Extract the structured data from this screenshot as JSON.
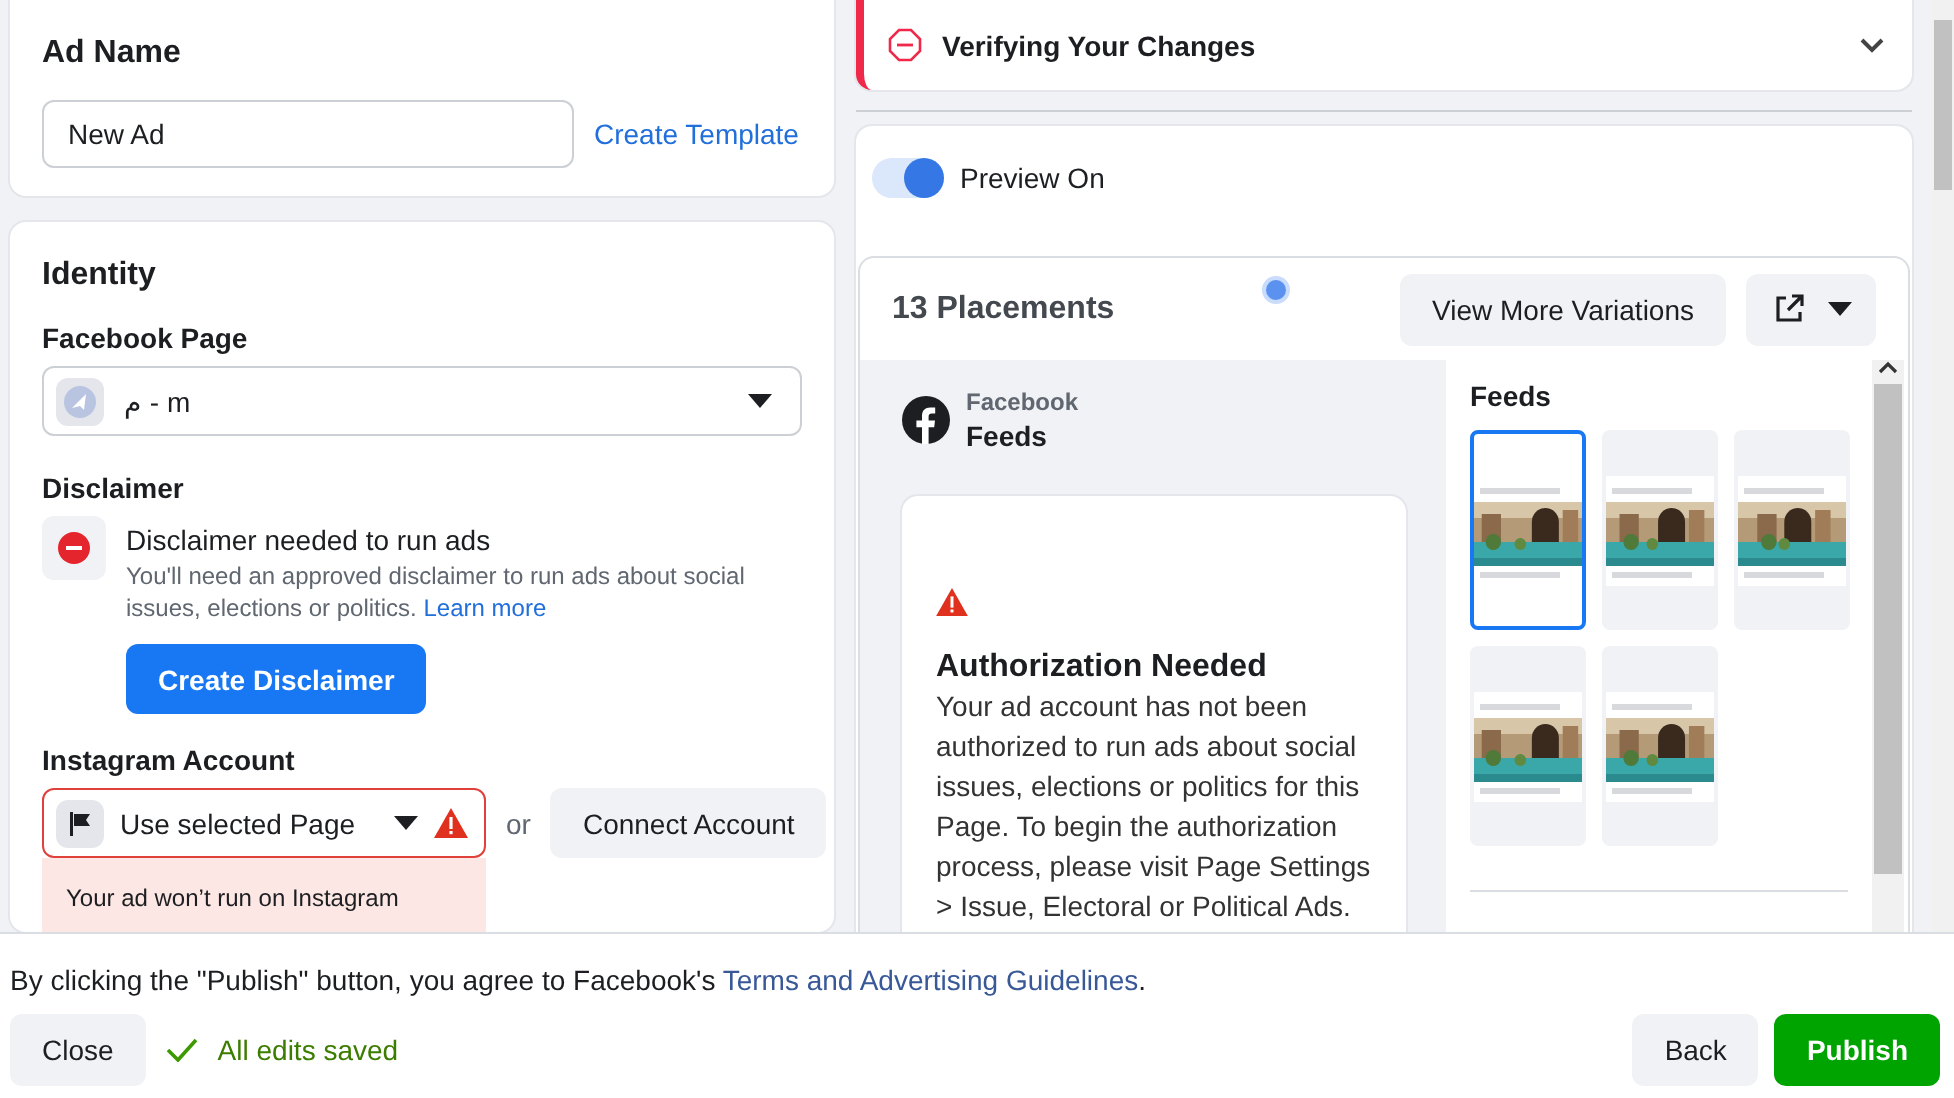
{
  "ad_name": {
    "title": "Ad Name",
    "value": "New Ad",
    "link": "Create Template"
  },
  "identity": {
    "title": "Identity",
    "facebook_page": {
      "label": "Facebook Page",
      "value": "م - m"
    },
    "disclaimer": {
      "label": "Disclaimer",
      "title": "Disclaimer needed to run ads",
      "text": "You'll need an approved disclaimer to run ads about social issues, elections or politics.",
      "link": "Learn more",
      "button": "Create Disclaimer"
    },
    "instagram": {
      "label": "Instagram Account",
      "value": "Use selected Page",
      "error": true,
      "or": "or",
      "button": "Connect Account",
      "warning": "Your ad won’t run on Instagram"
    }
  },
  "verification": {
    "title": "Verifying Your Changes",
    "expanded": false
  },
  "preview": {
    "on": true,
    "label": "Preview On",
    "placements": "13 Placements",
    "variations_button": "View More Variations",
    "platform": "Facebook",
    "placement": "Feeds",
    "notice": {
      "title": "Authorization Needed",
      "text": "Your ad account has not been authorized to run ads about social issues, elections or politics for this Page. To begin the authorization process, please visit Page Settings > Issue, Electoral or Political Ads."
    },
    "thumbnails_title": "Feeds",
    "thumbnails": [
      {
        "selected": true
      },
      {
        "selected": false
      },
      {
        "selected": false
      },
      {
        "selected": false
      },
      {
        "selected": false
      }
    ]
  },
  "footer": {
    "agreement": "By clicking the \"Publish\" button, you agree to Facebook's",
    "agreement_link": "Terms and Advertising Guidelines",
    "agreement_end": ".",
    "close": "Close",
    "status": "All edits saved",
    "back": "Back",
    "publish": "Publish"
  }
}
